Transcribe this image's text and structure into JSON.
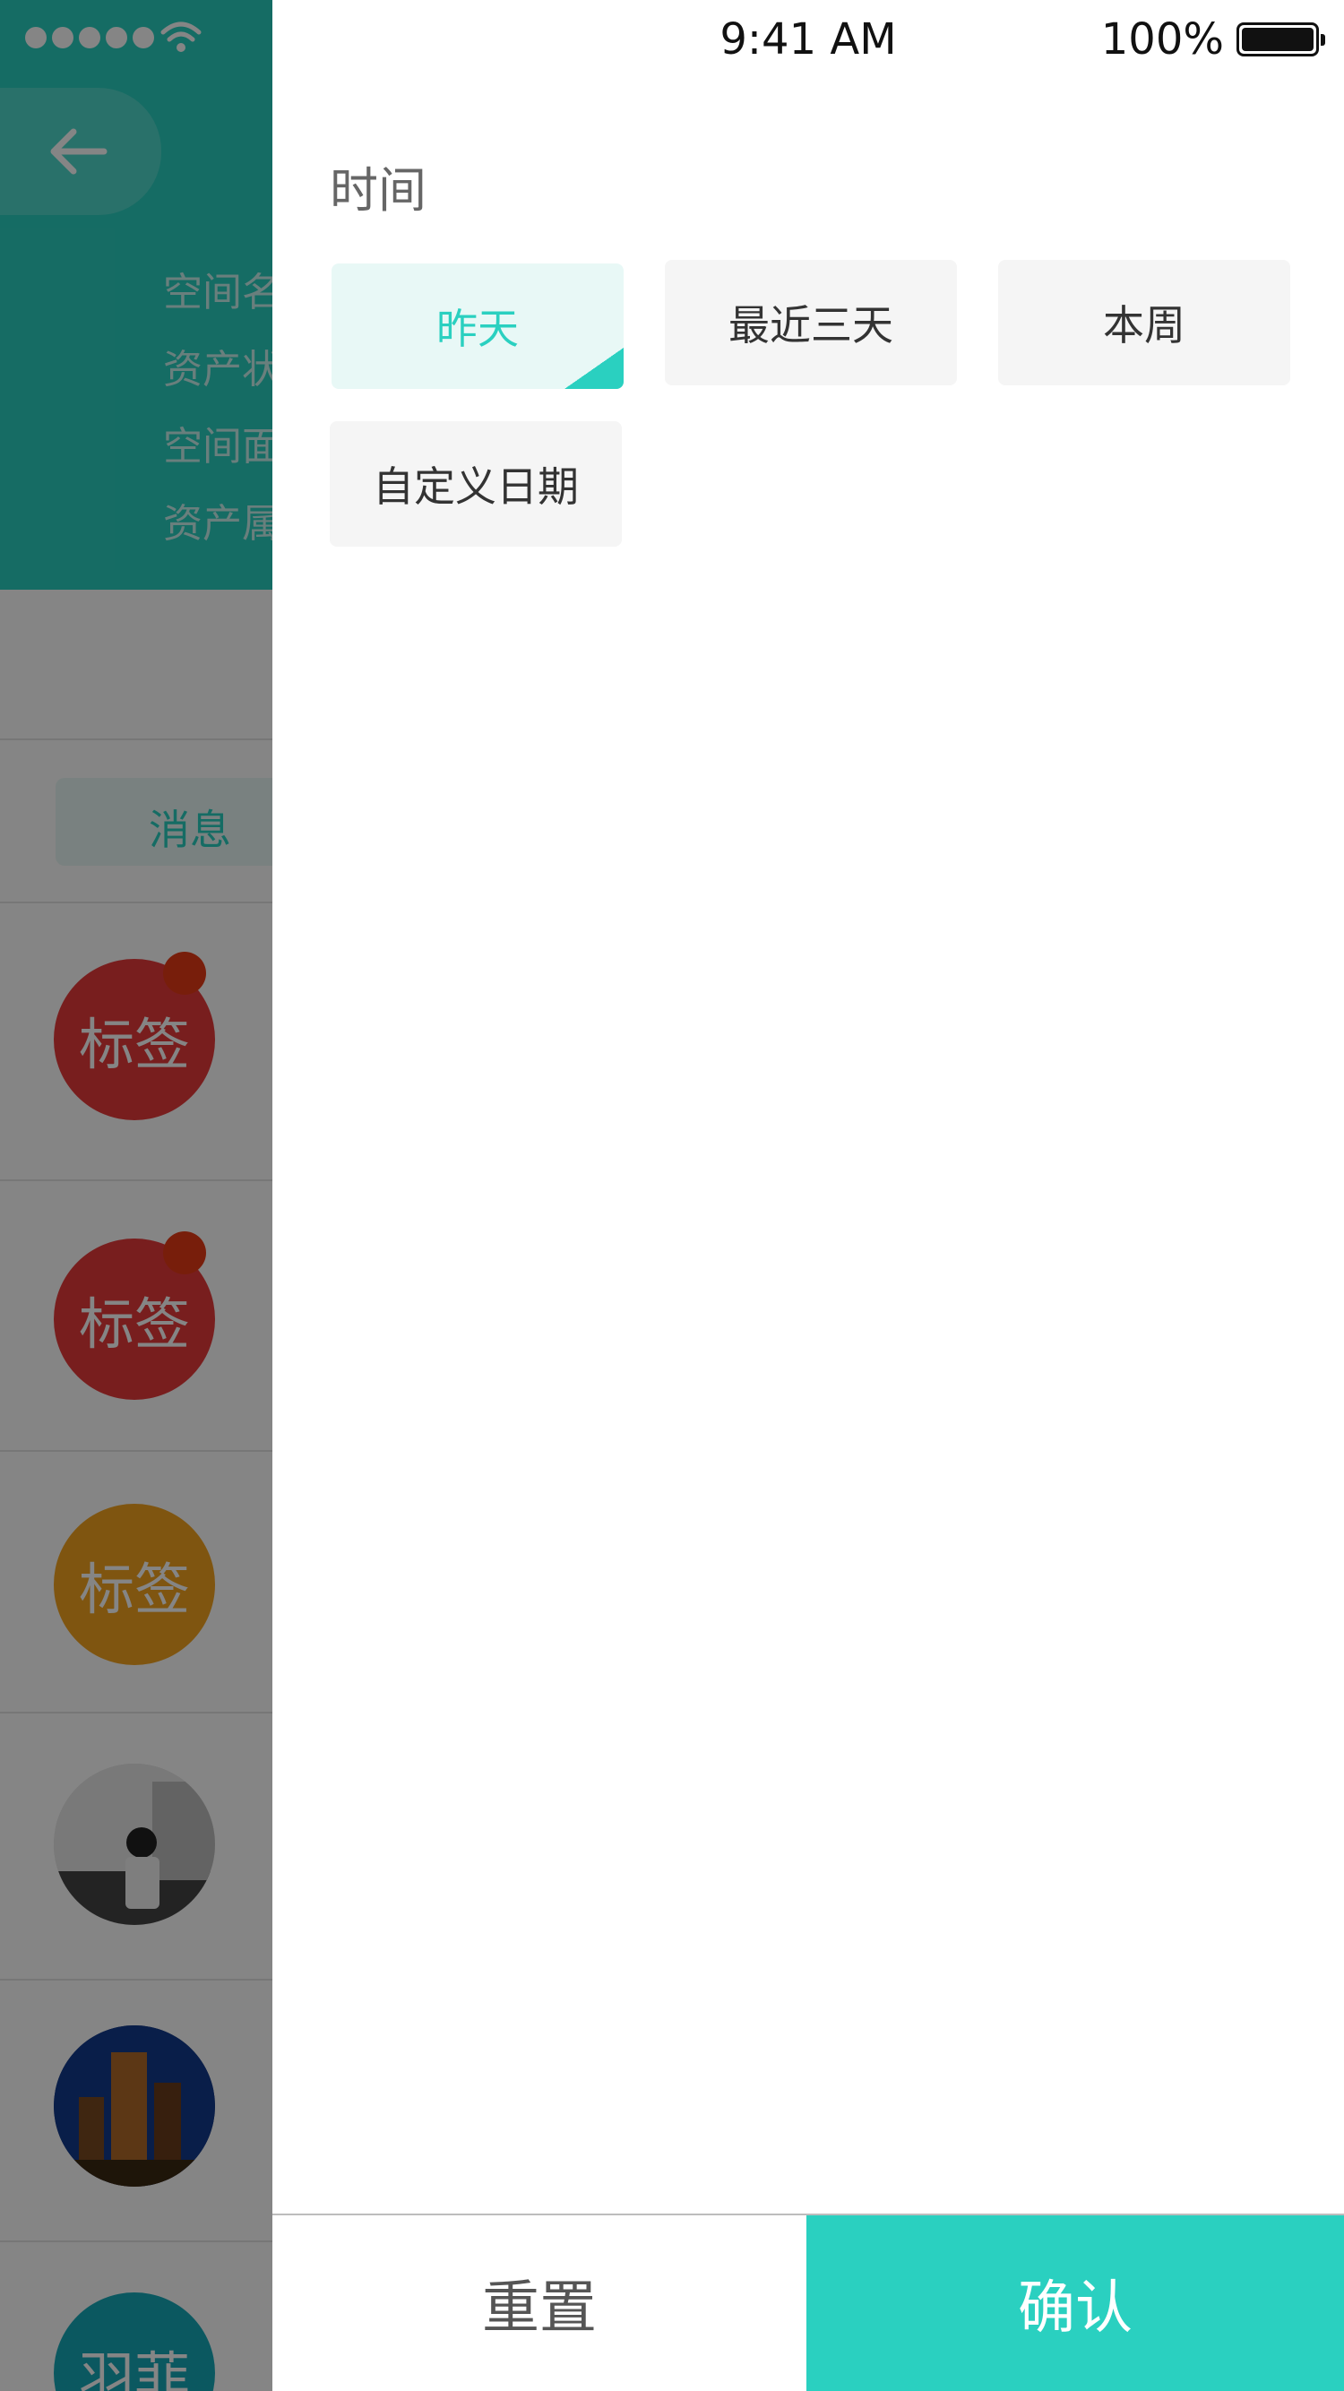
{
  "status_bar": {
    "time": "9:41 AM",
    "battery": "100%"
  },
  "background": {
    "info_lines": [
      "空间名",
      "资产状",
      "空间面",
      "资产属"
    ],
    "message_tab": "消息",
    "list_items": [
      {
        "kind": "tag",
        "label": "标签",
        "color": "#e63a3a",
        "unread": true
      },
      {
        "kind": "tag",
        "label": "标签",
        "color": "#e63a3a",
        "unread": true
      },
      {
        "kind": "tag",
        "label": "标签",
        "color": "#f3a31f",
        "unread": false
      },
      {
        "kind": "photo",
        "icon": "person-photo-avatar"
      },
      {
        "kind": "photo",
        "icon": "city-night-photo-avatar"
      },
      {
        "kind": "tag",
        "label": "羽菲",
        "color": "#16a9b8",
        "unread": false
      }
    ]
  },
  "filter": {
    "section_title": "时间",
    "options": [
      {
        "label": "昨天",
        "selected": true
      },
      {
        "label": "最近三天",
        "selected": false
      },
      {
        "label": "本周",
        "selected": false
      },
      {
        "label": "自定义日期",
        "selected": false
      }
    ]
  },
  "actions": {
    "reset": "重置",
    "confirm": "确认"
  },
  "colors": {
    "accent": "#2ad0c0",
    "selected_bg": "#e8f8f6",
    "chip_bg": "#f5f5f5"
  }
}
